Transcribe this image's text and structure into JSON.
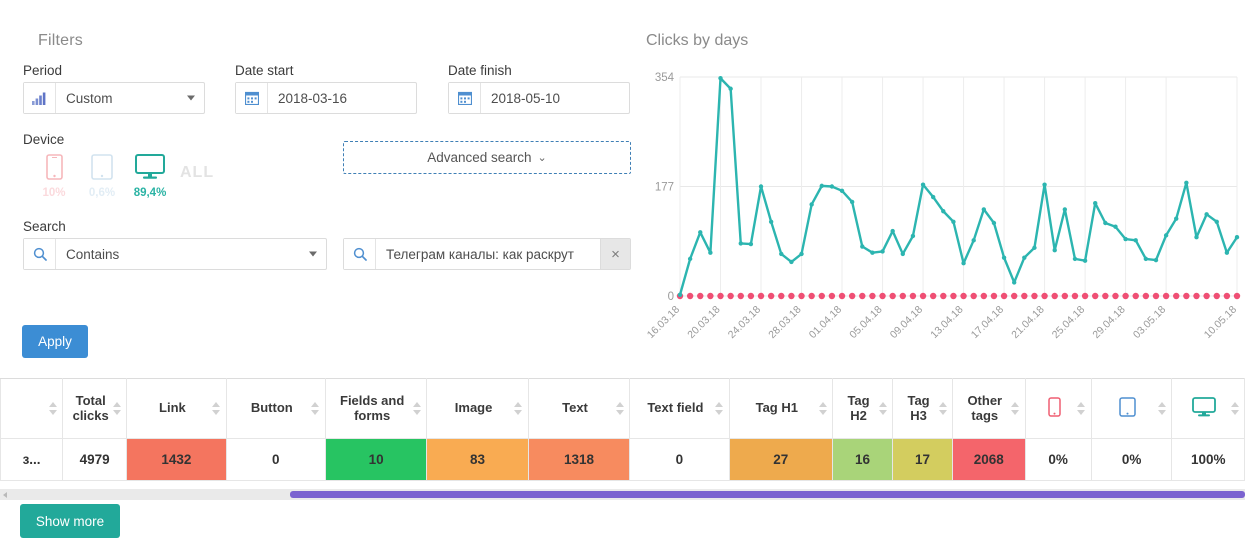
{
  "filters": {
    "title": "Filters",
    "period": {
      "label": "Period",
      "value": "Custom",
      "icon": "bar-chart-icon"
    },
    "date_start": {
      "label": "Date start",
      "value": "2018-03-16",
      "icon": "calendar-icon"
    },
    "date_finish": {
      "label": "Date finish",
      "value": "2018-05-10",
      "icon": "calendar-icon"
    },
    "device": {
      "label": "Device",
      "all_label": "ALL",
      "items": [
        {
          "name": "phone",
          "pct": "10%",
          "color": "#f4a3a8",
          "active": false
        },
        {
          "name": "tablet",
          "pct": "0,6%",
          "color": "#c2d8e8",
          "active": false
        },
        {
          "name": "desktop",
          "pct": "89,4%",
          "color": "#22a99a",
          "active": true
        }
      ]
    },
    "advanced_search": {
      "label": "Advanced search",
      "chevron": "chevron-down-icon"
    },
    "search": {
      "label": "Search",
      "mode": "Contains",
      "query": "Телеграм каналы: как раскрут",
      "placeholder": "",
      "clear": "×"
    },
    "apply_label": "Apply"
  },
  "chart_data": {
    "type": "line",
    "title": "Clicks by days",
    "xlabel": "",
    "ylabel": "",
    "ylim": [
      0,
      354
    ],
    "yticks": [
      0,
      177,
      354
    ],
    "ytick_labels": [
      "0",
      "177",
      "354"
    ],
    "grid": true,
    "legend": false,
    "xtick_labels": [
      "16.03.18",
      "20.03.18",
      "24.03.18",
      "28.03.18",
      "01.04.18",
      "05.04.18",
      "09.04.18",
      "13.04.18",
      "17.04.18",
      "21.04.18",
      "25.04.18",
      "29.04.18",
      "03.05.18",
      "10.05.18"
    ],
    "xtick_index": [
      0,
      4,
      8,
      12,
      16,
      20,
      24,
      28,
      32,
      36,
      40,
      44,
      48,
      55
    ],
    "x": [
      "16.03.18",
      "17.03.18",
      "18.03.18",
      "19.03.18",
      "20.03.18",
      "21.03.18",
      "22.03.18",
      "23.03.18",
      "24.03.18",
      "25.03.18",
      "26.03.18",
      "27.03.18",
      "28.03.18",
      "29.03.18",
      "30.03.18",
      "31.03.18",
      "01.04.18",
      "02.04.18",
      "03.04.18",
      "04.04.18",
      "05.04.18",
      "06.04.18",
      "07.04.18",
      "08.04.18",
      "09.04.18",
      "10.04.18",
      "11.04.18",
      "12.04.18",
      "13.04.18",
      "14.04.18",
      "15.04.18",
      "16.04.18",
      "17.04.18",
      "18.04.18",
      "19.04.18",
      "20.04.18",
      "21.04.18",
      "22.04.18",
      "23.04.18",
      "24.04.18",
      "25.04.18",
      "26.04.18",
      "27.04.18",
      "28.04.18",
      "29.04.18",
      "30.04.18",
      "01.05.18",
      "02.05.18",
      "03.05.18",
      "04.05.18",
      "05.05.18",
      "06.05.18",
      "07.05.18",
      "08.05.18",
      "09.05.18",
      "10.05.18"
    ],
    "series": [
      {
        "name": "Clicks",
        "color": "#2cb5b0",
        "values": [
          2,
          60,
          103,
          70,
          352,
          335,
          85,
          84,
          177,
          120,
          68,
          55,
          68,
          148,
          178,
          177,
          170,
          152,
          80,
          70,
          72,
          105,
          68,
          97,
          180,
          160,
          137,
          120,
          53,
          90,
          140,
          118,
          62,
          22,
          62,
          78,
          180,
          74,
          140,
          60,
          57,
          150,
          118,
          112,
          92,
          90,
          60,
          58,
          98,
          125,
          183,
          95,
          132,
          120,
          70,
          95
        ]
      },
      {
        "name": "Baseline",
        "color": "#ef4f74",
        "style": "dotted-markers",
        "values": [
          0,
          0,
          0,
          0,
          0,
          0,
          0,
          0,
          0,
          0,
          0,
          0,
          0,
          0,
          0,
          0,
          0,
          0,
          0,
          0,
          0,
          0,
          0,
          0,
          0,
          0,
          0,
          0,
          0,
          0,
          0,
          0,
          0,
          0,
          0,
          0,
          0,
          0,
          0,
          0,
          0,
          0,
          0,
          0,
          0,
          0,
          0,
          0,
          0,
          0,
          0,
          0,
          0,
          0,
          0,
          0
        ]
      }
    ]
  },
  "table": {
    "columns": [
      {
        "key": "name",
        "label": "",
        "icon": "",
        "sortable": true
      },
      {
        "key": "total_clicks",
        "label": "Total clicks",
        "sortable": true
      },
      {
        "key": "link",
        "label": "Link",
        "sortable": true
      },
      {
        "key": "button",
        "label": "Button",
        "sortable": true
      },
      {
        "key": "fields_and_forms",
        "label": "Fields and forms",
        "sortable": true
      },
      {
        "key": "image",
        "label": "Image",
        "sortable": true
      },
      {
        "key": "text",
        "label": "Text",
        "sortable": true
      },
      {
        "key": "text_field",
        "label": "Text field",
        "sortable": true
      },
      {
        "key": "tag_h1",
        "label": "Tag H1",
        "sortable": true
      },
      {
        "key": "tag_h2",
        "label": "Tag H2",
        "sortable": true
      },
      {
        "key": "tag_h3",
        "label": "Tag H3",
        "sortable": true
      },
      {
        "key": "other_tags",
        "label": "Other tags",
        "sortable": true
      },
      {
        "key": "phone",
        "label": "",
        "icon": "phone-icon",
        "sortable": true
      },
      {
        "key": "tablet",
        "label": "",
        "icon": "tablet-icon",
        "sortable": true
      },
      {
        "key": "desktop",
        "label": "",
        "icon": "desktop-icon",
        "sortable": true
      }
    ],
    "rows": [
      {
        "name": "з...",
        "total_clicks": "4979",
        "link": "1432",
        "button": "0",
        "fields_and_forms": "10",
        "image": "83",
        "text": "1318",
        "text_field": "0",
        "tag_h1": "27",
        "tag_h2": "16",
        "tag_h3": "17",
        "other_tags": "2068",
        "phone": "0%",
        "tablet": "0%",
        "desktop": "100%"
      }
    ],
    "cell_colors": {
      "link": "#f4755f",
      "fields_and_forms": "#27c462",
      "image": "#f9ab52",
      "text": "#f78b5f",
      "tag_h1": "#eeaa4d",
      "tag_h2": "#a9d479",
      "tag_h3": "#d3cd5f",
      "other_tags": "#f4656b"
    },
    "scrollbar_color": "#7b63d0"
  },
  "footer": {
    "show_more_label": "Show more"
  }
}
